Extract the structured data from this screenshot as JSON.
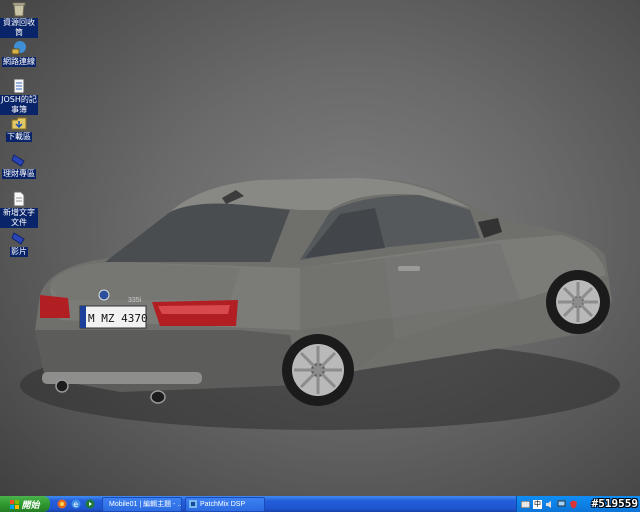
{
  "desktop": {
    "icons": [
      {
        "label": "資源回收筒",
        "icon": "recycle-bin-icon"
      },
      {
        "label": "網路連線",
        "icon": "network-connections-icon"
      },
      {
        "label": "JOSH的記事簿",
        "icon": "notebook-icon"
      },
      {
        "label": "下載區",
        "icon": "downloads-icon"
      },
      {
        "label": "理財專區",
        "icon": "finance-icon"
      },
      {
        "label": "新增文字文件",
        "icon": "text-document-icon"
      },
      {
        "label": "影片",
        "icon": "video-icon"
      }
    ],
    "wallpaper": {
      "plate_text": "M MZ 4370",
      "badge_text": "335i"
    }
  },
  "taskbar": {
    "start_label": "開始",
    "tasks": [
      {
        "label": "Mobile01 | 編輯主題 - ..."
      },
      {
        "label": "PatchMix DSP"
      }
    ],
    "tray": {
      "ime": "中"
    },
    "watermark": "#519559"
  },
  "colors": {
    "taskbar_blue": "#245edb",
    "start_green": "#2f9a2f",
    "tray_blue": "#0c74d6",
    "icon_label_bg": "#0a246a"
  }
}
